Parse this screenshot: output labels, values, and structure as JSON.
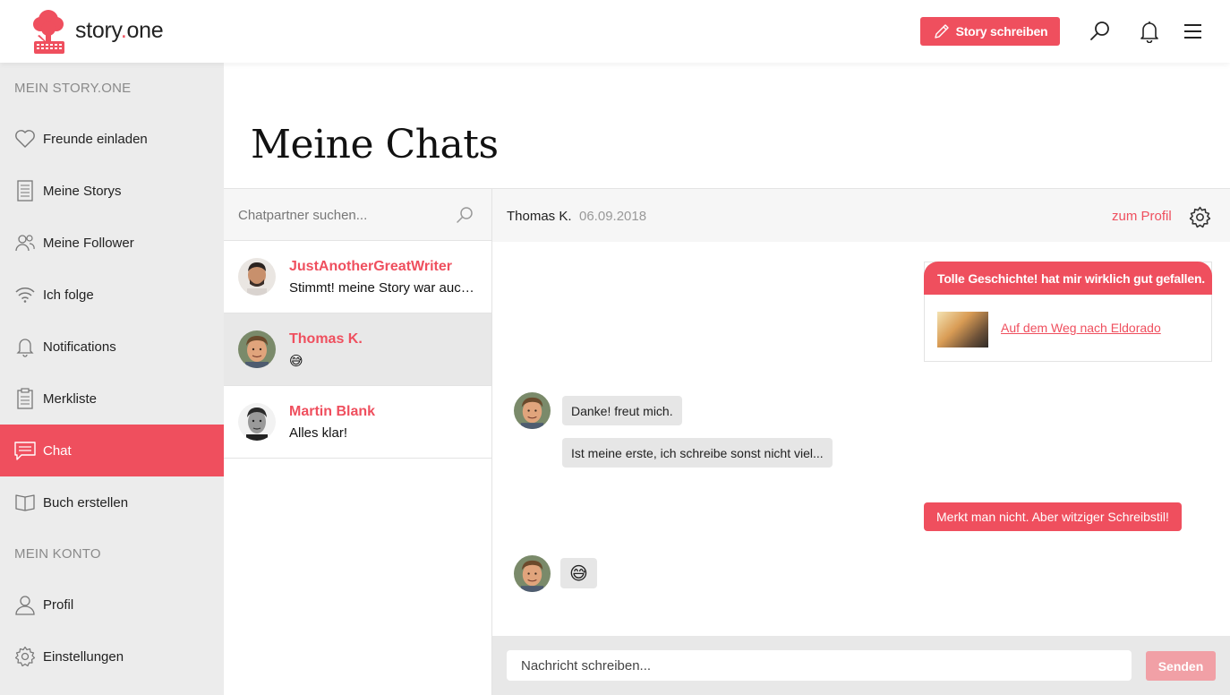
{
  "header": {
    "logo_text_main": "story",
    "logo_text_dot": ".",
    "logo_text_end": "one",
    "write_button": "Story schreiben"
  },
  "sidebar": {
    "section_my": "MEIN STORY.ONE",
    "section_account": "MEIN KONTO",
    "items": [
      {
        "label": "Freunde einladen",
        "icon": "heart-icon"
      },
      {
        "label": "Meine Storys",
        "icon": "document-icon"
      },
      {
        "label": "Meine Follower",
        "icon": "users-icon"
      },
      {
        "label": "Ich folge",
        "icon": "wifi-icon"
      },
      {
        "label": "Notifications",
        "icon": "bell-icon"
      },
      {
        "label": "Merkliste",
        "icon": "clipboard-icon"
      },
      {
        "label": "Chat",
        "icon": "chat-icon",
        "active": true
      },
      {
        "label": "Buch erstellen",
        "icon": "book-icon"
      }
    ],
    "account_items": [
      {
        "label": "Profil",
        "icon": "user-icon"
      },
      {
        "label": "Einstellungen",
        "icon": "gear-icon"
      }
    ]
  },
  "page": {
    "title": "Meine Chats"
  },
  "chatlist": {
    "search_placeholder": "Chatpartner suchen...",
    "chats": [
      {
        "name": "JustAnotherGreatWriter",
        "preview": "Stimmt! meine Story war auch nicht so gut..."
      },
      {
        "name": "Thomas K.",
        "preview": "😅",
        "active": true
      },
      {
        "name": "Martin Blank",
        "preview": "Alles klar!"
      }
    ]
  },
  "conversation": {
    "partner": "Thomas K.",
    "date": "06.09.2018",
    "profile_link": "zum Profil",
    "card_message": "Tolle Geschichte! hat mir wirklich gut gefallen.",
    "card_link": "Auf dem Weg nach Eldorado",
    "messages": [
      {
        "from": "them",
        "text": "Danke! freut mich."
      },
      {
        "from": "them",
        "text": "Ist meine erste, ich schreibe sonst nicht viel..."
      },
      {
        "from": "me",
        "text": "Merkt man nicht.  Aber witziger Schreibstil!"
      },
      {
        "from": "them",
        "text": "😅"
      }
    ],
    "composer_placeholder": "Nachricht schreiben...",
    "send_label": "Senden"
  },
  "colors": {
    "accent": "#ef4f5e",
    "accent_light": "#f1a0a6",
    "sidebar_bg": "#ececec"
  }
}
